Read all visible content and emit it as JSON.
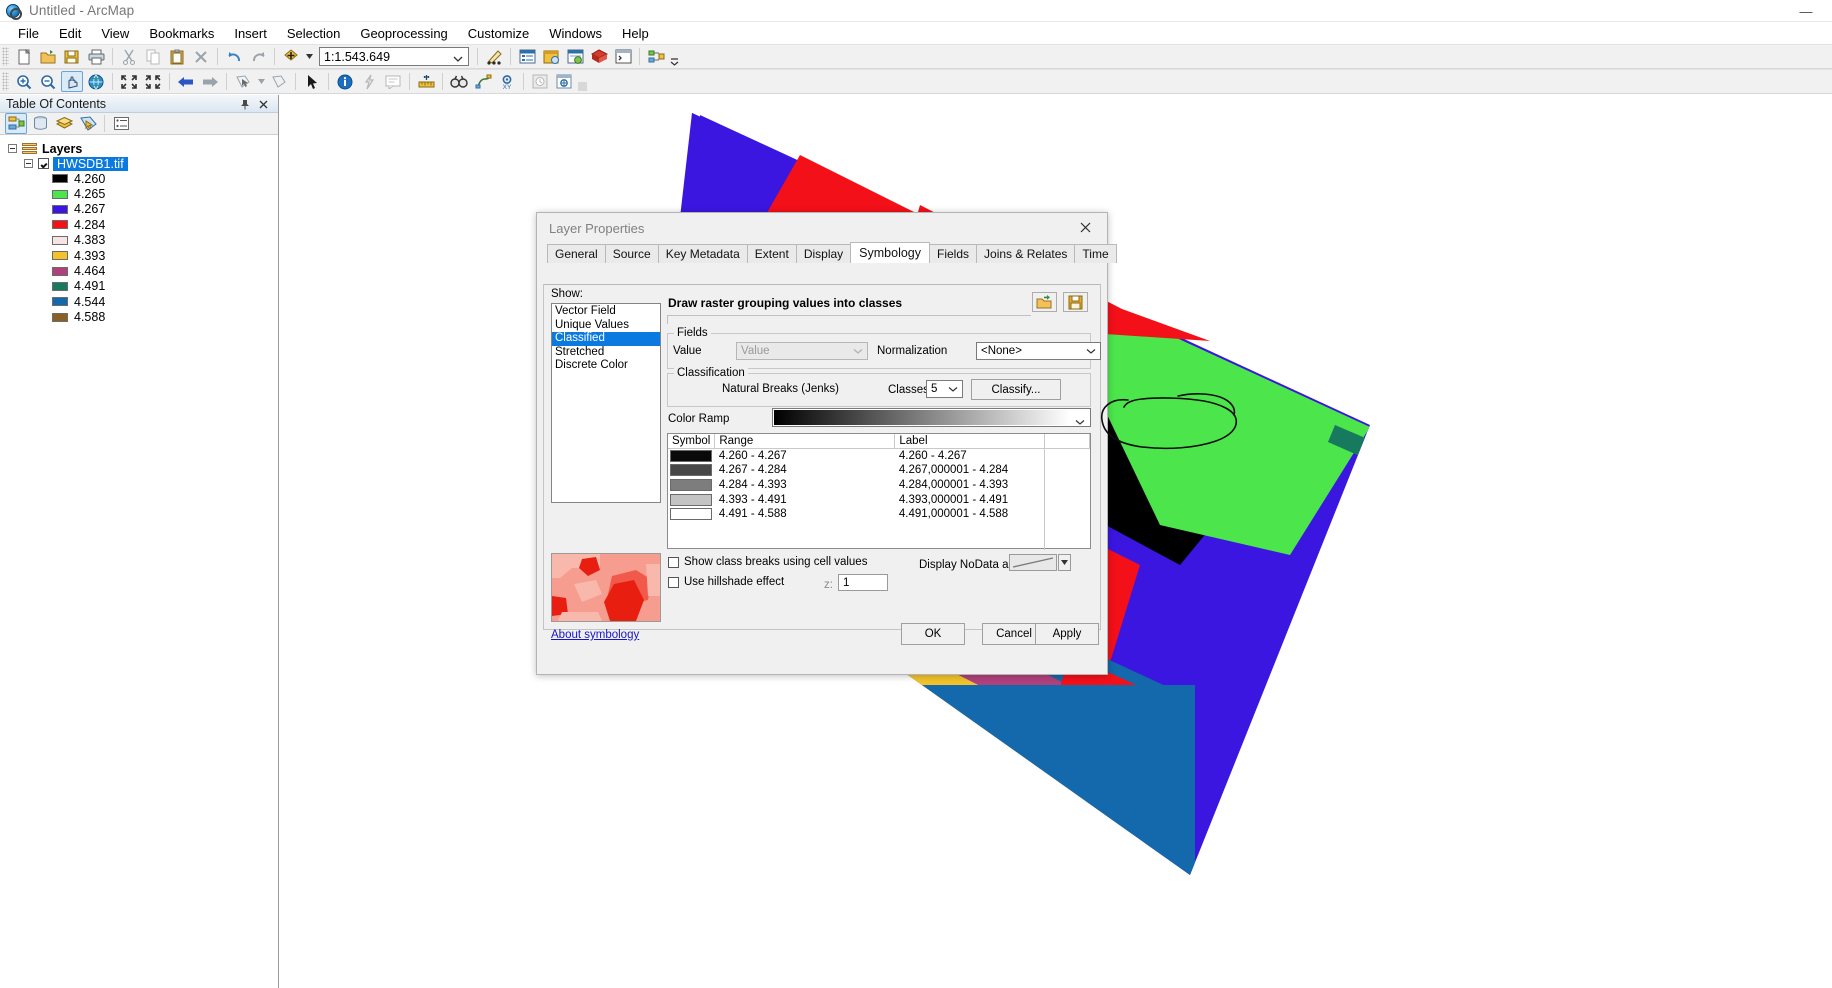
{
  "window": {
    "title": "Untitled - ArcMap",
    "app_icon": "arcmap-globe-icon",
    "minimize_label": "—"
  },
  "menubar": {
    "items": [
      "File",
      "Edit",
      "View",
      "Bookmarks",
      "Insert",
      "Selection",
      "Geoprocessing",
      "Customize",
      "Windows",
      "Help"
    ]
  },
  "toolbar_standard": {
    "scale_value": "1:1.543.649",
    "icons": [
      "new-document-icon",
      "open-folder-icon",
      "save-icon",
      "print-icon",
      "cut-icon",
      "copy-icon",
      "paste-icon",
      "delete-icon",
      "undo-icon",
      "redo-icon",
      "add-data-icon",
      "editor-toolbar-icon",
      "table-of-contents-icon",
      "catalog-window-icon",
      "search-window-icon",
      "arctoolbox-icon",
      "python-window-icon",
      "model-builder-icon"
    ]
  },
  "toolbar_tools": {
    "icons": [
      "zoom-in-icon",
      "zoom-out-icon",
      "pan-icon",
      "full-extent-icon",
      "fixed-zoom-in-icon",
      "fixed-zoom-out-icon",
      "back-extent-icon",
      "forward-extent-icon",
      "select-features-icon",
      "clear-selection-icon",
      "select-elements-icon",
      "identify-icon",
      "hyperlink-icon",
      "html-popup-icon",
      "measure-icon",
      "find-icon",
      "find-route-icon",
      "go-to-xy-icon",
      "time-slider-icon",
      "create-viewer-window-icon"
    ],
    "active": "pan-icon"
  },
  "toc": {
    "header_title": "Table Of Contents",
    "pin_icon": "pin-icon",
    "close_icon": "close-icon",
    "toolbar_icons": [
      "list-by-drawing-order-icon",
      "list-by-source-icon",
      "list-by-visibility-icon",
      "list-by-selection-icon",
      "options-icon"
    ],
    "active_toolbar_icon": "list-by-drawing-order-icon",
    "root": "Layers",
    "layer": {
      "name": "HWSDB1.tif",
      "checked": true,
      "selected": true
    },
    "legend": [
      {
        "value": "4.260",
        "color": "#000000"
      },
      {
        "value": "4.265",
        "color": "#4ce64c"
      },
      {
        "value": "4.267",
        "color": "#3b16e0"
      },
      {
        "value": "4.284",
        "color": "#f41019"
      },
      {
        "value": "4.383",
        "color": "#f7e3e6"
      },
      {
        "value": "4.393",
        "color": "#f2c42a"
      },
      {
        "value": "4.464",
        "color": "#b0417d"
      },
      {
        "value": "4.491",
        "color": "#17795e"
      },
      {
        "value": "4.544",
        "color": "#1369ab"
      },
      {
        "value": "4.588",
        "color": "#8a6024"
      }
    ]
  },
  "dialog": {
    "title": "Layer Properties",
    "close_icon": "close-icon",
    "tabs": [
      {
        "label": "General",
        "selected": false
      },
      {
        "label": "Source",
        "selected": false
      },
      {
        "label": "Key Metadata",
        "selected": false
      },
      {
        "label": "Extent",
        "selected": false
      },
      {
        "label": "Display",
        "selected": false
      },
      {
        "label": "Symbology",
        "selected": true
      },
      {
        "label": "Fields",
        "selected": false
      },
      {
        "label": "Joins & Relates",
        "selected": false
      },
      {
        "label": "Time",
        "selected": false
      }
    ],
    "show": {
      "label": "Show:",
      "items": [
        {
          "label": "Vector Field",
          "selected": false
        },
        {
          "label": "Unique Values",
          "selected": false
        },
        {
          "label": "Classified",
          "selected": true
        },
        {
          "label": "Stretched",
          "selected": false
        },
        {
          "label": "Discrete Color",
          "selected": false
        }
      ]
    },
    "about_link": "About symbology",
    "draw_title": "Draw raster grouping values into classes",
    "import_icon": "import-symbology-icon",
    "save_icon": "save-symbology-icon",
    "fields": {
      "group_label": "Fields",
      "value_label": "Value",
      "value_select": "Value",
      "normalization_label": "Normalization",
      "normalization_select": "<None>"
    },
    "classification": {
      "group_label": "Classification",
      "method": "Natural Breaks (Jenks)",
      "classes_label": "Classes",
      "classes_value": "5",
      "classify_button": "Classify..."
    },
    "color_ramp": {
      "label": "Color Ramp",
      "ramp_start": "#000000",
      "ramp_end": "#ffffff"
    },
    "table": {
      "headers": [
        "Symbol",
        "Range",
        "Label"
      ],
      "rows": [
        {
          "color": "#0a0a0a",
          "range": "4.260 - 4.267",
          "label": "4.260 - 4.267"
        },
        {
          "color": "#474747",
          "range": "4.267 - 4.284",
          "label": "4.267,000001 - 4.284"
        },
        {
          "color": "#7d7d7d",
          "range": "4.284 - 4.393",
          "label": "4.284,000001 - 4.393"
        },
        {
          "color": "#c3c3c3",
          "range": "4.393 - 4.491",
          "label": "4.393,000001 - 4.491"
        },
        {
          "color": "#ffffff",
          "range": "4.491 - 4.588",
          "label": "4.491,000001 - 4.588"
        }
      ]
    },
    "options": {
      "show_class_breaks": {
        "label": "Show class breaks using cell values",
        "checked": false
      },
      "use_hillshade": {
        "label": "Use hillshade effect",
        "checked": false
      },
      "z_label": "z:",
      "z_value": "1",
      "nodata_label": "Display NoData as"
    },
    "buttons": {
      "ok": "OK",
      "cancel": "Cancel",
      "apply": "Apply"
    },
    "annotation": "hand-drawn-ellipse-around-classify"
  },
  "map": {
    "background": "#ffffff",
    "raster_colors": {
      "black": "#000000",
      "green": "#4ce64c",
      "blue": "#3b16e0",
      "red": "#f41019",
      "pink": "#f7e3e6",
      "yellow": "#f2c42a",
      "magenta": "#b0417d",
      "teal": "#17795e",
      "steel_blue": "#1369ab",
      "brown": "#8a6024"
    }
  }
}
